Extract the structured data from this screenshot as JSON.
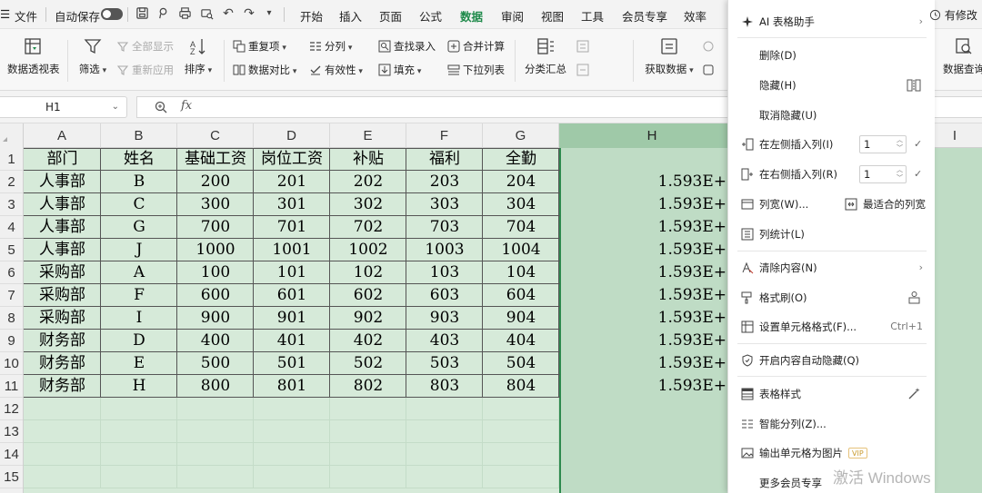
{
  "menubar": {
    "file_label": "文件",
    "autosave_label": "自动保存",
    "tabs": [
      {
        "label": "开始",
        "active": false
      },
      {
        "label": "插入",
        "active": false
      },
      {
        "label": "页面",
        "active": false
      },
      {
        "label": "公式",
        "active": false
      },
      {
        "label": "数据",
        "active": true
      },
      {
        "label": "审阅",
        "active": false
      },
      {
        "label": "视图",
        "active": false
      },
      {
        "label": "工具",
        "active": false
      },
      {
        "label": "会员专享",
        "active": false
      },
      {
        "label": "效率",
        "active": false
      }
    ],
    "edit_status": "有修改",
    "accent_color": "#1e8a4a"
  },
  "ribbon": {
    "pivot_table": "数据透视表",
    "filter": "筛选",
    "show_all": "全部显示",
    "reapply": "重新应用",
    "sort": "排序",
    "duplicates": "重复项",
    "compare": "数据对比",
    "split_column": "分列",
    "validity": "有效性",
    "lookup_entry": "查找录入",
    "fill": "填充",
    "consolidate": "合并计算",
    "dropdown_list": "下拉列表",
    "subtotal": "分类汇总",
    "get_data": "获取数据",
    "data_query": "数据查询"
  },
  "formula_bar": {
    "cell_ref": "H1",
    "fx_label": "fx",
    "formula": ""
  },
  "sheet": {
    "columns": [
      "A",
      "B",
      "C",
      "D",
      "E",
      "F",
      "G",
      "H"
    ],
    "next_column": "I",
    "rows": [
      "1",
      "2",
      "3",
      "4",
      "5",
      "6",
      "7",
      "8",
      "9",
      "10",
      "11",
      "12",
      "13",
      "14",
      "15"
    ],
    "selected_column": "H",
    "header_row": [
      "部门",
      "姓名",
      "基础工资",
      "岗位工资",
      "补贴",
      "福利",
      "全勤"
    ],
    "data_rows": [
      [
        "人事部",
        "B",
        "200",
        "201",
        "202",
        "203",
        "204",
        "1.593E+"
      ],
      [
        "人事部",
        "C",
        "300",
        "301",
        "302",
        "303",
        "304",
        "1.593E+"
      ],
      [
        "人事部",
        "G",
        "700",
        "701",
        "702",
        "703",
        "704",
        "1.593E+"
      ],
      [
        "人事部",
        "J",
        "1000",
        "1001",
        "1002",
        "1003",
        "1004",
        "1.593E+"
      ],
      [
        "采购部",
        "A",
        "100",
        "101",
        "102",
        "103",
        "104",
        "1.593E+"
      ],
      [
        "采购部",
        "F",
        "600",
        "601",
        "602",
        "603",
        "604",
        "1.593E+"
      ],
      [
        "采购部",
        "I",
        "900",
        "901",
        "902",
        "903",
        "904",
        "1.593E+"
      ],
      [
        "财务部",
        "D",
        "400",
        "401",
        "402",
        "403",
        "404",
        "1.593E+"
      ],
      [
        "财务部",
        "E",
        "500",
        "501",
        "502",
        "503",
        "504",
        "1.593E+"
      ],
      [
        "财务部",
        "H",
        "800",
        "801",
        "802",
        "803",
        "804",
        "1.593E+"
      ]
    ],
    "selection_fill": "#d6ead9"
  },
  "context_menu": {
    "ai_assistant": "AI 表格助手",
    "delete": "删除(D)",
    "hide": "隐藏(H)",
    "unhide": "取消隐藏(U)",
    "insert_left": "在左侧插入列(I)",
    "insert_left_count": "1",
    "insert_right": "在右侧插入列(R)",
    "insert_right_count": "1",
    "column_width": "列宽(W)...",
    "best_fit_width": "最适合的列宽",
    "column_stats": "列统计(L)",
    "clear_contents": "清除内容(N)",
    "format_painter": "格式刷(O)",
    "format_cells": "设置单元格格式(F)...",
    "format_cells_shortcut": "Ctrl+1",
    "auto_hide": "开启内容自动隐藏(Q)",
    "table_style": "表格样式",
    "smart_split": "智能分列(Z)...",
    "export_as_image": "输出单元格为图片",
    "vip_badge": "VIP",
    "more_member": "更多会员专享"
  },
  "watermark": "激活 Windows"
}
